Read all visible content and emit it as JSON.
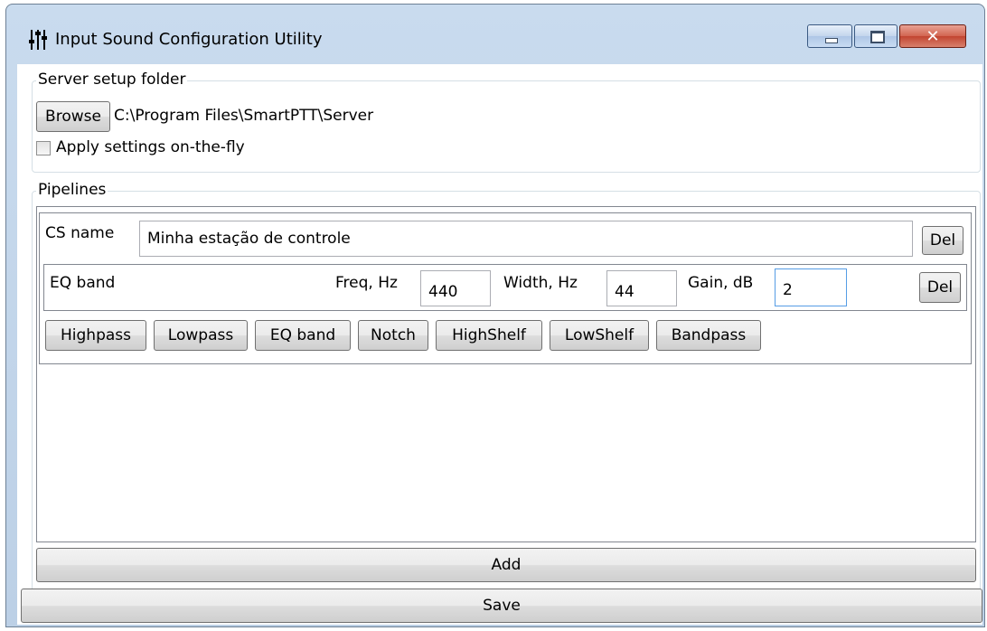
{
  "window": {
    "title": "Input Sound Configuration Utility",
    "icon": "sliders-icon",
    "controls": {
      "minimize": "minimize-icon",
      "maximize": "maximize-icon",
      "close": "close-icon"
    }
  },
  "server_setup": {
    "legend": "Server setup folder",
    "browse_label": "Browse",
    "path": "C:\\Program Files\\SmartPTT\\Server",
    "apply_label": "Apply settings on-the-fly",
    "apply_checked": false
  },
  "pipelines": {
    "legend": "Pipelines",
    "cs_name_label": "CS name",
    "cs_name_value": "Minha estação de controle",
    "cs_del_label": "Del",
    "band": {
      "type": "EQ band",
      "freq_label": "Freq, Hz",
      "freq_value": "440",
      "width_label": "Width, Hz",
      "width_value": "44",
      "gain_label": "Gain, dB",
      "gain_value": "2",
      "del_label": "Del"
    },
    "filter_buttons": [
      "Highpass",
      "Lowpass",
      "EQ band",
      "Notch",
      "HighShelf",
      "LowShelf",
      "Bandpass"
    ],
    "add_label": "Add"
  },
  "save_label": "Save"
}
